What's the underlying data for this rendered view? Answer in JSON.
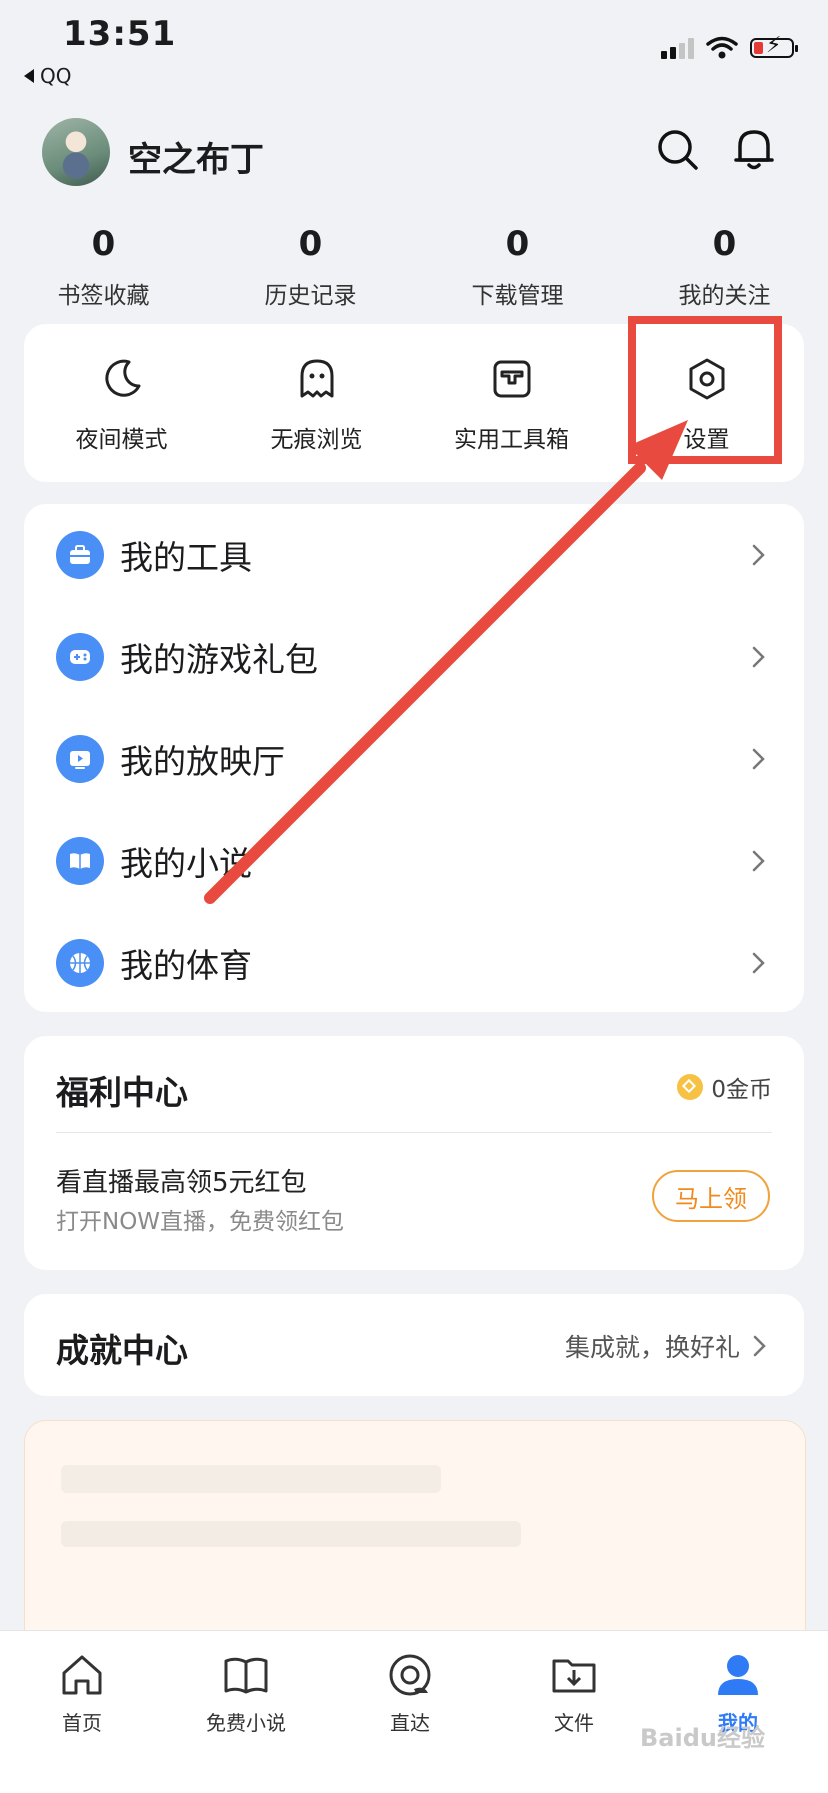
{
  "status_bar": {
    "time": "13:51",
    "back_app": "QQ"
  },
  "header": {
    "username": "空之布丁"
  },
  "stats": [
    {
      "value": "0",
      "label": "书签收藏"
    },
    {
      "value": "0",
      "label": "历史记录"
    },
    {
      "value": "0",
      "label": "下载管理"
    },
    {
      "value": "0",
      "label": "我的关注"
    }
  ],
  "quick_actions": [
    {
      "label": "夜间模式",
      "icon": "moon-icon"
    },
    {
      "label": "无痕浏览",
      "icon": "ghost-icon"
    },
    {
      "label": "实用工具箱",
      "icon": "toolbox-icon"
    },
    {
      "label": "设置",
      "icon": "settings-gear-icon"
    }
  ],
  "menu": [
    {
      "label": "我的工具",
      "icon": "briefcase-icon"
    },
    {
      "label": "我的游戏礼包",
      "icon": "gamepad-icon"
    },
    {
      "label": "我的放映厅",
      "icon": "play-screen-icon"
    },
    {
      "label": "我的小说",
      "icon": "book-icon"
    },
    {
      "label": "我的体育",
      "icon": "basketball-icon"
    }
  ],
  "welfare": {
    "title": "福利中心",
    "coins": "0金币",
    "promo_title": "看直播最高领5元红包",
    "promo_sub": "打开NOW直播，免费领红包",
    "claim_label": "马上领"
  },
  "achievement": {
    "title": "成就中心",
    "link": "集成就，换好礼"
  },
  "tabbar": [
    {
      "label": "首页",
      "icon": "home-icon"
    },
    {
      "label": "免费小说",
      "icon": "open-book-icon"
    },
    {
      "label": "直达",
      "icon": "direct-icon"
    },
    {
      "label": "文件",
      "icon": "folder-download-icon"
    },
    {
      "label": "我的",
      "icon": "user-icon",
      "active": true
    }
  ],
  "watermark": "Baidu经验",
  "colors": {
    "accent": "#2f7bf5",
    "annotation": "#e84a3f",
    "claim": "#f08a1c",
    "icon_bg": "#4a8ff5"
  }
}
